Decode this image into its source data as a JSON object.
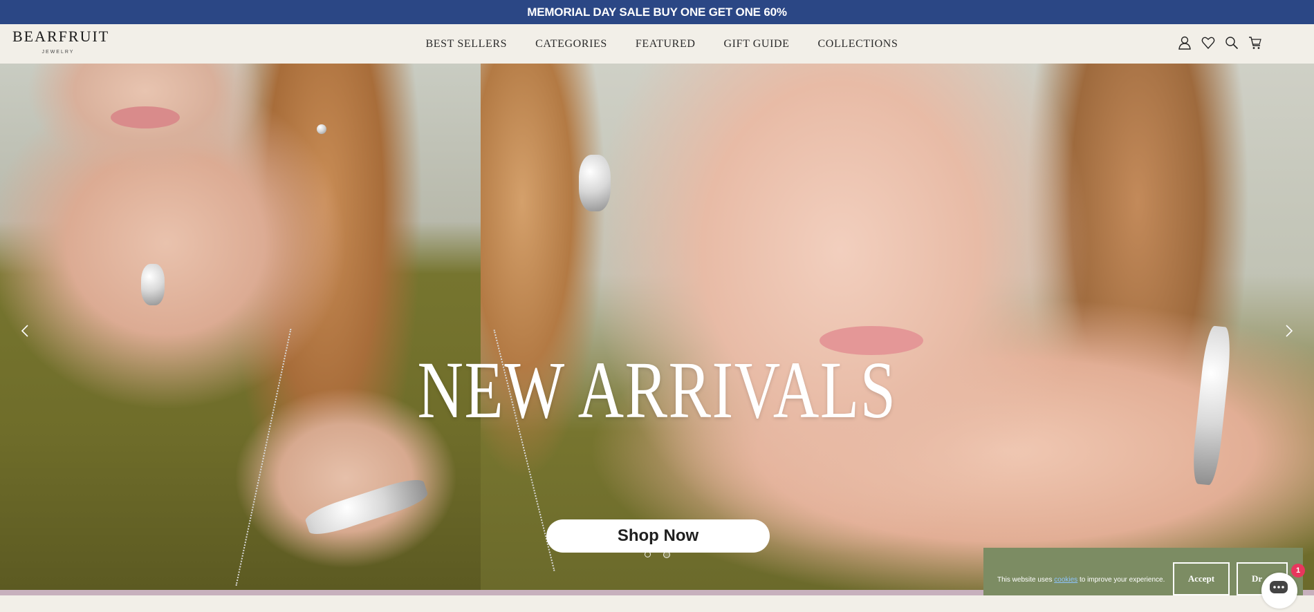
{
  "announcement": {
    "text": "MEMORIAL DAY SALE BUY ONE GET ONE 60%"
  },
  "brand": {
    "name": "BEARFRUIT",
    "subtitle": "JEWELRY"
  },
  "nav": {
    "items": [
      {
        "label": "BEST SELLERS"
      },
      {
        "label": "CATEGORIES"
      },
      {
        "label": "FEATURED"
      },
      {
        "label": "GIFT GUIDE"
      },
      {
        "label": "COLLECTIONS"
      }
    ]
  },
  "header_icons": [
    "account-icon",
    "wishlist-heart-icon",
    "search-icon",
    "cart-icon"
  ],
  "hero": {
    "title": "NEW ARRIVALS",
    "cta_label": "Shop Now",
    "slide_count": 2,
    "active_slide": 2
  },
  "cookie_banner": {
    "text_before": "This website uses ",
    "link_text": "cookies",
    "text_after": " to improve your experience.",
    "accept_label": "Accept",
    "decline_label": "Dr"
  },
  "chat": {
    "badge_count": "1"
  },
  "colors": {
    "announcement_bg": "#2b4785",
    "header_bg": "#f2efe8",
    "cookie_bg": "#7c8c63",
    "chat_badge": "#e8365d"
  }
}
